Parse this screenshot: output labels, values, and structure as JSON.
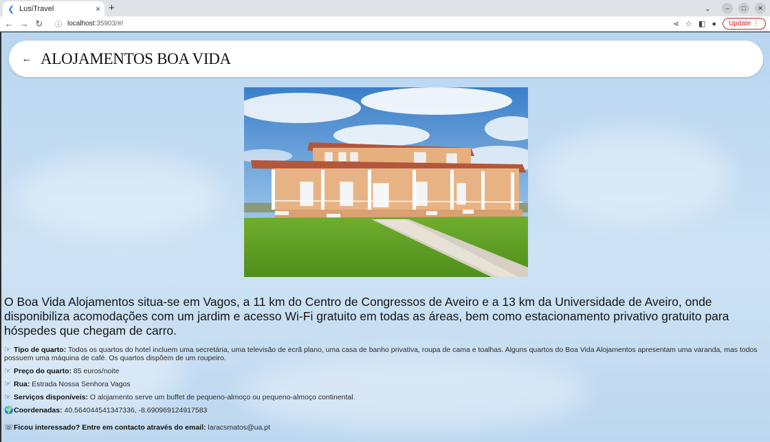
{
  "browser": {
    "tab_title": "LusiTravel",
    "tab_close": "×",
    "new_tab": "+",
    "url_host": "localhost",
    "url_path": ":35903/#/",
    "update_label": "Update"
  },
  "header": {
    "back": "←",
    "title": "ALOJAMENTOS BOA VIDA"
  },
  "intro": "O Boa Vida Alojamentos situa-se em Vagos, a 11 km do Centro de Congressos de Aveiro e a 13 km da Universidade de Aveiro, onde disponibiliza acomodações com um jardim e acesso Wi-Fi gratuito em todas as áreas, bem como estacionamento privativo gratuito para hóspedes que chegam de carro.",
  "details": {
    "room_type_label": "Tipo de quarto:",
    "room_type_value": " Todos os quartos do hotel incluem uma secretária, uma televisão de ecrã plano, uma casa de banho privativa, roupa de cama e toalhas. Alguns quartos do Boa Vida Alojamentos apresentam uma varanda, mas todos possuem uma máquina de café. Os quartos dispõem de um roupeiro.",
    "price_label": "Preço do quarto:",
    "price_value": " 85 euros/noite",
    "street_label": "Rua:",
    "street_value": " Estrada Nossa Senhora Vagos",
    "services_label": "Serviços disponíveis:",
    "services_value": " O alojamento serve um buffet de pequeno-almoço ou pequeno-almoço continental.",
    "coords_label": "Coordenadas:",
    "coords_value": " 40.564044541347336, -8.690969124917583",
    "contact_label": "Ficou interessado? Entre em contacto através do email:",
    "contact_value": " laracsmatos@ua.pt"
  },
  "icons": {
    "pointing_hand": "☞",
    "globe": "🌍",
    "phone": "☏"
  }
}
